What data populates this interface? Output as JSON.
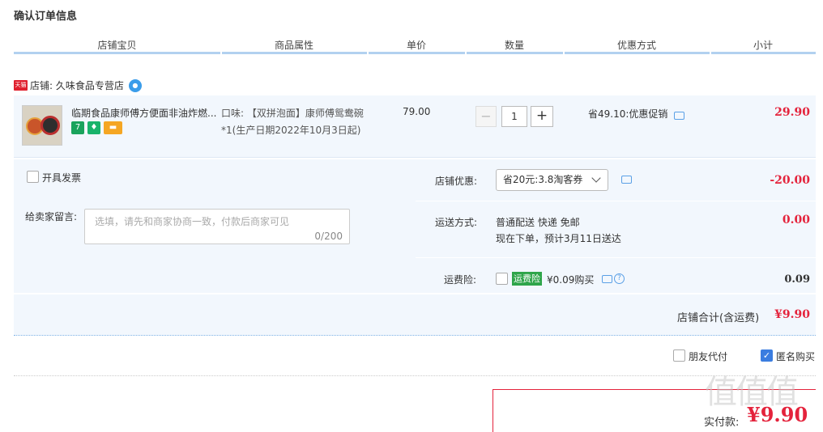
{
  "page_title": "确认订单信息",
  "columns": [
    "店铺宝贝",
    "商品属性",
    "单价",
    "数量",
    "优惠方式",
    "小计"
  ],
  "shop": {
    "badge": "天猫",
    "name": "店铺: 久味食品专营店",
    "wangwang_icon": "wangwang-chat-icon"
  },
  "item": {
    "title": "临期食品康师傅方便面非油炸燃...",
    "tags": [
      {
        "text": "7",
        "color": "#1aa35c",
        "icon": "seven-day-return-icon"
      },
      {
        "text": "♦",
        "color": "#19b36b",
        "icon": "guarantee-icon"
      },
      {
        "text": "▬",
        "color": "#f5a623",
        "icon": "card-pay-icon"
      }
    ],
    "attr_line1": "口味: 【双拼泡面】康师傅鸳鸯碗",
    "attr_line2": "*1(生产日期2022年10月3日起)",
    "unit_price": "79.00",
    "quantity": "1",
    "minus": "−",
    "plus": "+",
    "discount": "省49.10:优惠促销",
    "subtotal": "29.90"
  },
  "invoice_label": "开具发票",
  "message": {
    "label": "给卖家留言:",
    "placeholder": "选填，请先和商家协商一致，付款后商家可见",
    "counter": "0/200"
  },
  "shop_coupon": {
    "label": "店铺优惠:",
    "selected": "省20元:3.8淘客券",
    "amount": "-20.00"
  },
  "shipping": {
    "label": "运送方式:",
    "line1": "普通配送 快递 免邮",
    "line2": "现在下单，预计3月11日送达",
    "amount": "0.00"
  },
  "insurance": {
    "label": "运费险:",
    "tag": "运费险",
    "price_text": "¥0.09购买",
    "help": "?",
    "amount": "0.09"
  },
  "shop_total": {
    "label": "店铺合计(含运费)",
    "amount": "¥9.90"
  },
  "friend_pay_label": "朋友代付",
  "anonymous_label": "匿名购买",
  "anonymous_checked": true,
  "pay": {
    "label": "实付款:",
    "total": "¥9.90"
  },
  "watermark": "值值值",
  "colors": {
    "accent_red": "#e4233c",
    "panel_bg": "#f2f7fd",
    "link_blue": "#3b7de0",
    "header_line": "#b2d1f0"
  }
}
